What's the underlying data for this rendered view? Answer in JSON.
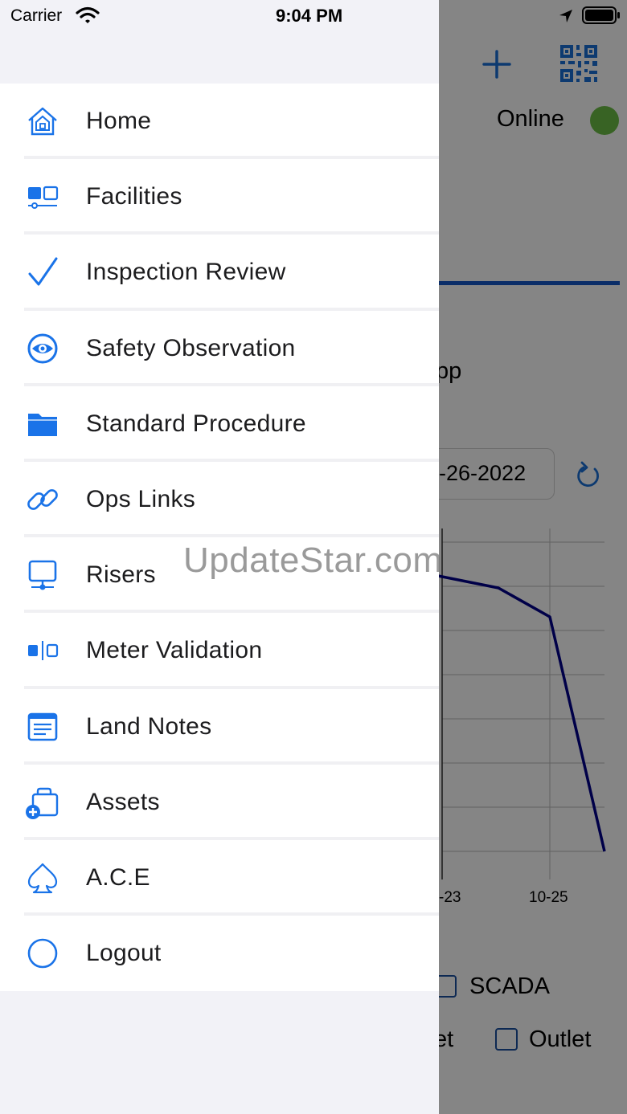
{
  "status_bar": {
    "carrier": "Carrier",
    "time": "9:04 PM"
  },
  "background_app": {
    "status_label": "Online",
    "status_color": "#6cbe45",
    "title_fragment": "pp",
    "date_fragment": "-26-2022",
    "chart_data": {
      "type": "line",
      "categories": [
        "-23",
        "10-25"
      ],
      "series": [
        {
          "values": [
            null,
            null
          ]
        }
      ],
      "title": "",
      "xlabel": "",
      "ylabel": "",
      "grid": true
    },
    "checkboxes": {
      "scada": "SCADA",
      "inlet_fragment": "et",
      "outlet": "Outlet"
    },
    "accent_color": "#1a6fd6"
  },
  "drawer": {
    "items": [
      {
        "label": "Home",
        "icon": "home-icon"
      },
      {
        "label": "Facilities",
        "icon": "facilities-icon"
      },
      {
        "label": "Inspection Review",
        "icon": "checkmark-icon"
      },
      {
        "label": "Safety Observation",
        "icon": "eye-icon"
      },
      {
        "label": "Standard Procedure",
        "icon": "folder-icon"
      },
      {
        "label": "Ops Links",
        "icon": "link-icon"
      },
      {
        "label": "Risers",
        "icon": "monitor-icon"
      },
      {
        "label": "Meter Validation",
        "icon": "meter-icon"
      },
      {
        "label": "Land Notes",
        "icon": "notes-icon"
      },
      {
        "label": "Assets",
        "icon": "assets-icon"
      },
      {
        "label": "A.C.E",
        "icon": "spade-icon"
      },
      {
        "label": "Logout",
        "icon": "circle-icon"
      }
    ],
    "icon_color": "#1a73e8"
  },
  "watermark": "UpdateStar.com"
}
